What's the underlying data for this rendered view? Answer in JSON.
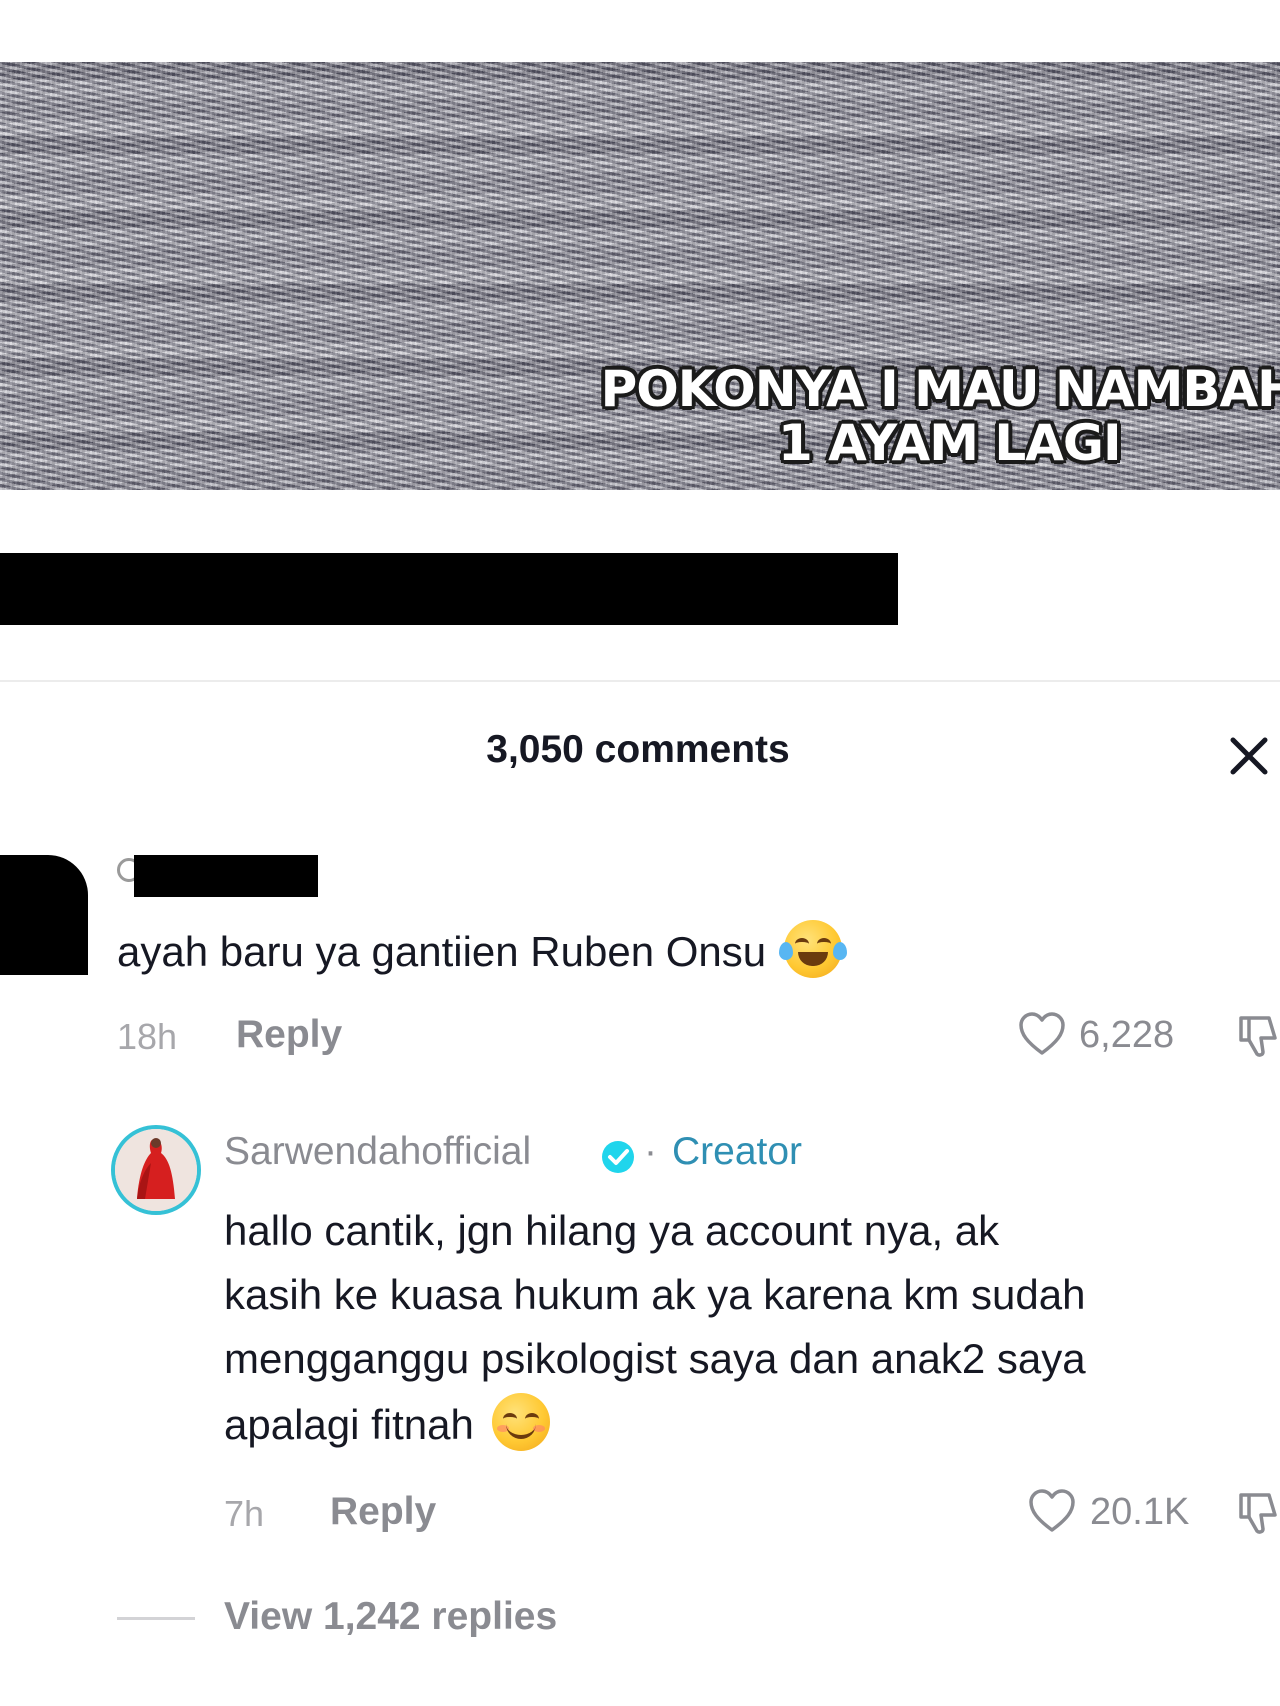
{
  "video": {
    "caption_line1": "POKONYA I MAU NAMBAH",
    "caption_line2": "1 AYAM LAGI"
  },
  "comments_panel": {
    "title": "3,050 comments",
    "close_icon": "close-icon"
  },
  "comments": [
    {
      "text": "ayah baru ya gantiien Ruben Onsu",
      "emoji": "face-with-tears-of-joy",
      "time": "18h",
      "reply_label": "Reply",
      "likes": "6,228"
    }
  ],
  "reply": {
    "username": "Sarwendahofficial",
    "verified": true,
    "separator": "·",
    "badge": "Creator",
    "lines": [
      "hallo cantik, jgn hilang ya account nya, ak",
      "kasih ke kuasa hukum ak ya karena km sudah",
      "mengganggu psikologist saya dan anak2 saya",
      "apalagi fitnah"
    ],
    "emoji": "smiling-face-with-smiling-eyes",
    "time": "7h",
    "reply_label": "Reply",
    "likes": "20.1K",
    "view_replies": "View 1,242 replies"
  },
  "colors": {
    "text_primary": "#161823",
    "text_secondary": "#8a8b91",
    "creator_accent": "#2f8fb3",
    "verified_blue": "#20d5ec"
  }
}
